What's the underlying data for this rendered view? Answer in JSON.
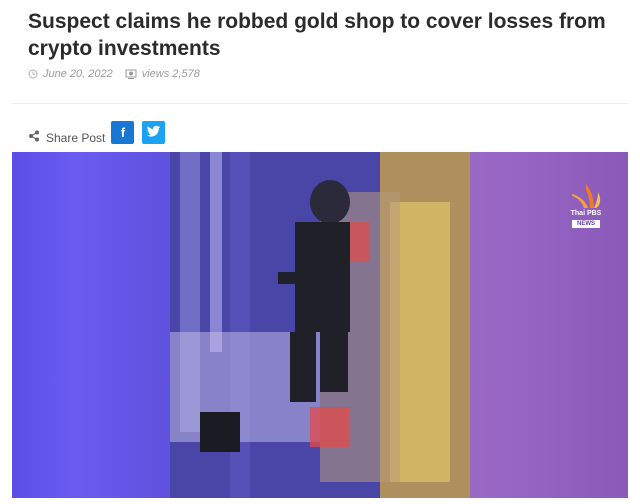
{
  "article": {
    "title": "Suspect claims he robbed gold shop to cover losses from crypto investments",
    "date": "June 20, 2022",
    "views": "views 2,578"
  },
  "share": {
    "label": "Share Post",
    "facebook": "f",
    "twitter": "t"
  },
  "image": {
    "logo_text": "Thai PBS",
    "logo_sub": "NEWS"
  }
}
